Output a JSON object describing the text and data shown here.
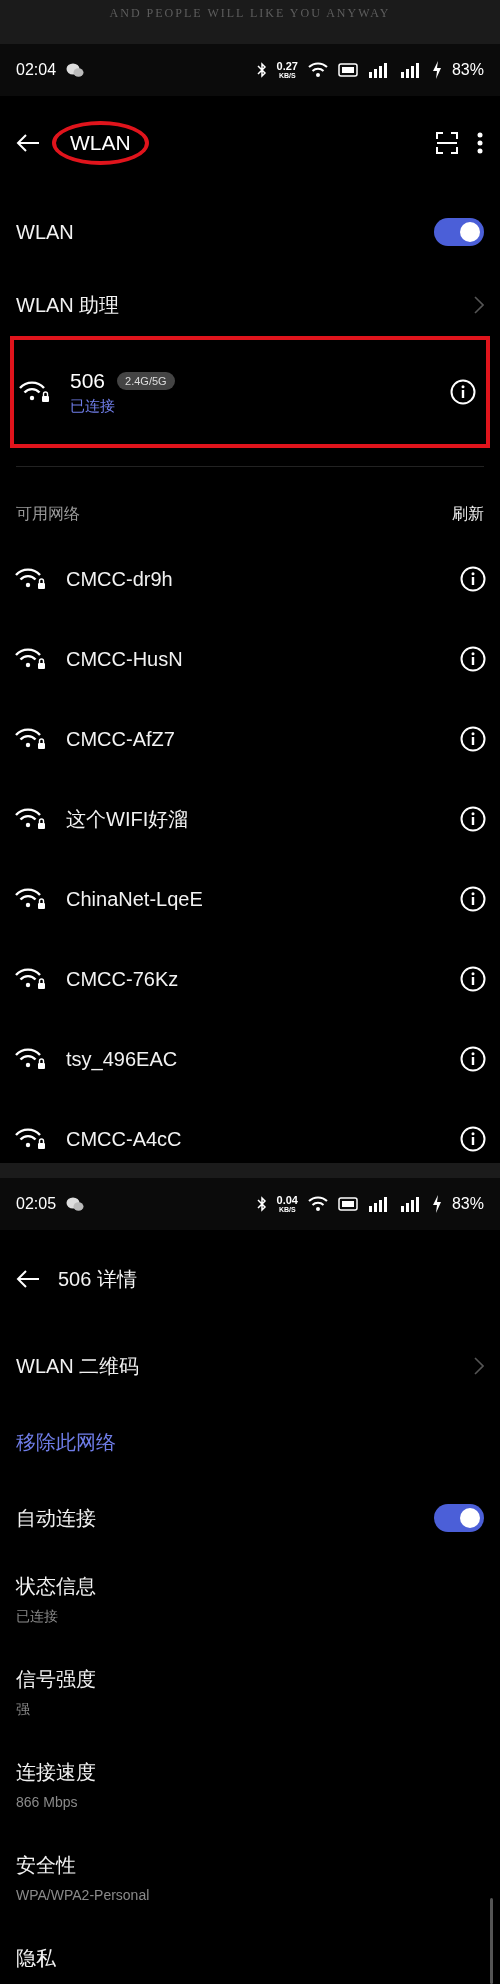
{
  "banner": {
    "text": "AND PEOPLE WILL LIKE YOU ANYWAY"
  },
  "screen_1": {
    "status_bar": {
      "time": "02:04",
      "speed": "0.27",
      "speed_unit": "KB/S",
      "battery": "83%"
    },
    "header": {
      "title": "WLAN",
      "circled": true
    },
    "wlan_toggle": {
      "label": "WLAN",
      "on": true
    },
    "assistant": {
      "label": "WLAN 助理"
    },
    "connected": {
      "name": "506",
      "band": "2.4G/5G",
      "status": "已连接",
      "highlighted": true
    },
    "available": {
      "title": "可用网络",
      "refresh": "刷新"
    },
    "networks": [
      {
        "name": "CMCC-dr9h"
      },
      {
        "name": "CMCC-HusN"
      },
      {
        "name": "CMCC-AfZ7"
      },
      {
        "name": "这个WIFI好溜"
      },
      {
        "name": "ChinaNet-LqeE"
      },
      {
        "name": "CMCC-76Kz"
      },
      {
        "name": "tsy_496EAC"
      },
      {
        "name": "CMCC-A4cC"
      }
    ]
  },
  "screen_2": {
    "status_bar": {
      "time": "02:05",
      "speed": "0.04",
      "speed_unit": "KB/S",
      "battery": "83%"
    },
    "header": {
      "title": "506 详情"
    },
    "qr": {
      "label": "WLAN 二维码"
    },
    "remove": {
      "label": "移除此网络"
    },
    "auto_connect": {
      "label": "自动连接",
      "on": true
    },
    "details": [
      {
        "label": "状态信息",
        "value": "已连接"
      },
      {
        "label": "信号强度",
        "value": "强"
      },
      {
        "label": "连接速度",
        "value": "866 Mbps"
      },
      {
        "label": "安全性",
        "value": "WPA/WPA2-Personal"
      },
      {
        "label": "隐私"
      }
    ]
  }
}
